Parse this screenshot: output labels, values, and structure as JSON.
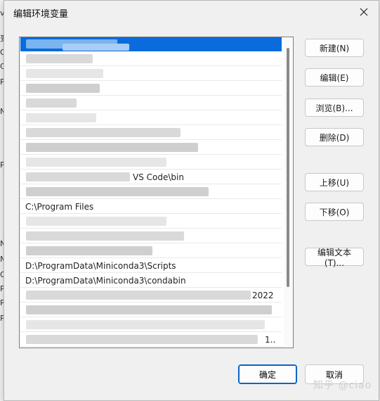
{
  "dialog": {
    "title": "编辑环境变量",
    "close_glyph": "✕"
  },
  "background_window": {
    "fragments": [
      "vi",
      "变",
      "Or",
      "C",
      "Pa",
      "N",
      "P",
      "N",
      "N",
      "OS",
      "Pa",
      "P",
      "PR"
    ]
  },
  "list": {
    "visible_paths": [
      {
        "index": 9,
        "text": "... VS Code\\bin"
      },
      {
        "index": 11,
        "text": "C:\\Program Files"
      },
      {
        "index": 15,
        "text": "D:\\ProgramData\\Miniconda3\\Scripts"
      },
      {
        "index": 16,
        "text": "D:\\ProgramData\\Miniconda3\\condabin"
      },
      {
        "index": 17,
        "text": "... 2022"
      },
      {
        "index": 20,
        "text": "1.."
      }
    ],
    "path_scripts": "D:\\ProgramData\\Miniconda3\\Scripts",
    "path_condabin": "D:\\ProgramData\\Miniconda3\\condabin",
    "path_program_files": "C:\\Program Files",
    "path_vscode_fragment": "VS Code\\bin",
    "path_2022_fragment": "2022",
    "path_last_fragment": "1.."
  },
  "buttons": {
    "new": "新建(N)",
    "edit": "编辑(E)",
    "browse": "浏览(B)...",
    "delete": "删除(D)",
    "move_up": "上移(U)",
    "move_down": "下移(O)",
    "edit_text": "编辑文本(T)...",
    "ok": "确定",
    "cancel": "取消"
  },
  "watermark": "知乎 @ciao",
  "colors": {
    "selection": "#0a6cdc",
    "accent_border": "#0a64c8"
  }
}
